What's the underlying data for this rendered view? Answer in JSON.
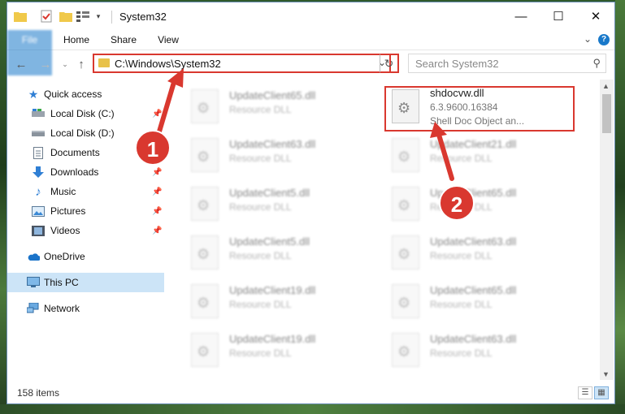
{
  "window": {
    "title": "System32",
    "controls": {
      "minimize": "—",
      "maximize": "☐",
      "close": "✕"
    }
  },
  "ribbon": {
    "tabs": [
      "File",
      "Home",
      "Share",
      "View"
    ],
    "help": "?"
  },
  "address": {
    "path": "C:\\Windows\\System32",
    "search_placeholder": "Search System32"
  },
  "nav_pane": {
    "items": [
      {
        "label": "Quick access",
        "icon": "star-icon",
        "pinned": false
      },
      {
        "label": "Local Disk (C:)",
        "icon": "drive-icon",
        "pinned": true
      },
      {
        "label": "Local Disk (D:)",
        "icon": "drive-icon",
        "pinned": false
      },
      {
        "label": "Documents",
        "icon": "documents-icon",
        "pinned": true
      },
      {
        "label": "Downloads",
        "icon": "downloads-icon",
        "pinned": true
      },
      {
        "label": "Music",
        "icon": "music-icon",
        "pinned": true
      },
      {
        "label": "Pictures",
        "icon": "pictures-icon",
        "pinned": true
      },
      {
        "label": "Videos",
        "icon": "videos-icon",
        "pinned": true
      },
      {
        "label": "OneDrive",
        "icon": "cloud-icon",
        "pinned": false
      },
      {
        "label": "This PC",
        "icon": "computer-icon",
        "pinned": false,
        "selected": true
      },
      {
        "label": "Network",
        "icon": "network-icon",
        "pinned": false
      }
    ]
  },
  "files": {
    "left_column": [
      {
        "name": "UpdateClient65.dll",
        "type": "Resource DLL"
      },
      {
        "name": "UpdateClient63.dll",
        "type": "Resource DLL"
      },
      {
        "name": "UpdateClient5.dll",
        "type": "Resource DLL"
      },
      {
        "name": "UpdateClient5.dll",
        "type": "Resource DLL"
      },
      {
        "name": "UpdateClient19.dll",
        "type": "Resource DLL"
      },
      {
        "name": "UpdateClient19.dll",
        "type": "Resource DLL"
      }
    ],
    "right_column": [
      {
        "name": "shdocvw.dll",
        "version": "6.3.9600.16384",
        "type": "Shell Doc Object an..."
      },
      {
        "name": "UpdateClient21.dll",
        "type": "Resource DLL"
      },
      {
        "name": "UpdateClient65.dll",
        "type": "Resource DLL"
      },
      {
        "name": "UpdateClient63.dll",
        "type": "Resource DLL"
      },
      {
        "name": "UpdateClient65.dll",
        "type": "Resource DLL"
      },
      {
        "name": "UpdateClient63.dll",
        "type": "Resource DLL"
      }
    ]
  },
  "status": {
    "item_count": "158 items"
  },
  "annotations": {
    "callout_1": "1",
    "callout_2": "2",
    "color": "#d9382f"
  }
}
